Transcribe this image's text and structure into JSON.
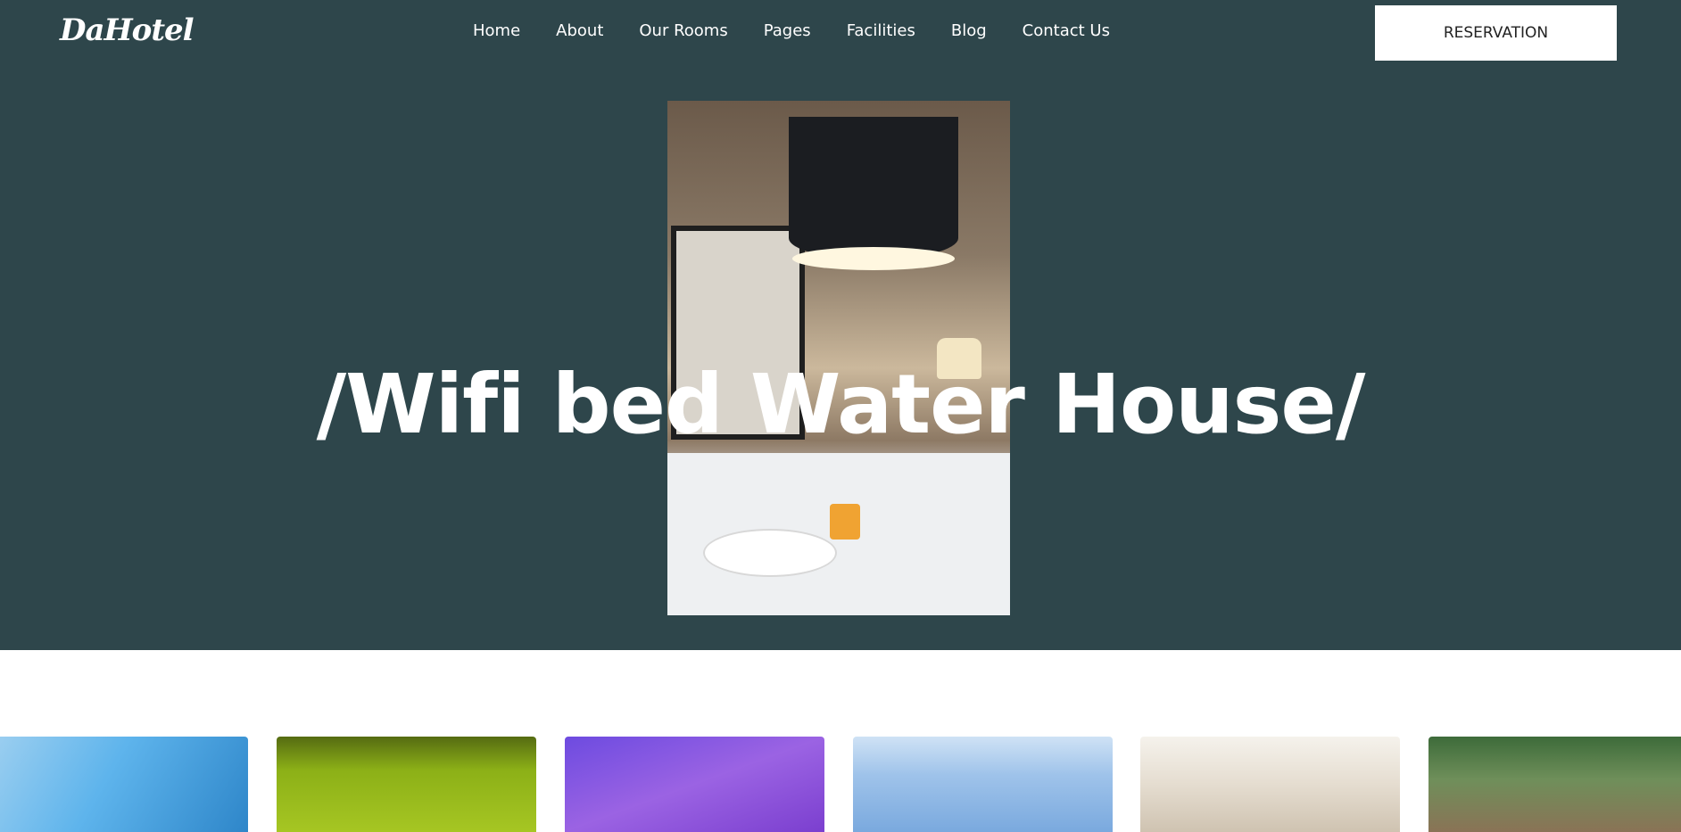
{
  "header": {
    "logo": "DaHotel",
    "nav": [
      "Home",
      "About",
      "Our Rooms",
      "Pages",
      "Facilities",
      "Blog",
      "Contact Us"
    ],
    "reservation_label": "RESERVATION"
  },
  "hero": {
    "title": "/Wifi bed Water House/"
  },
  "gallery": {
    "thumbnails": [
      "blue-room",
      "green-room",
      "purple-room",
      "light-blue-room",
      "beige-room",
      "water-villa"
    ]
  }
}
